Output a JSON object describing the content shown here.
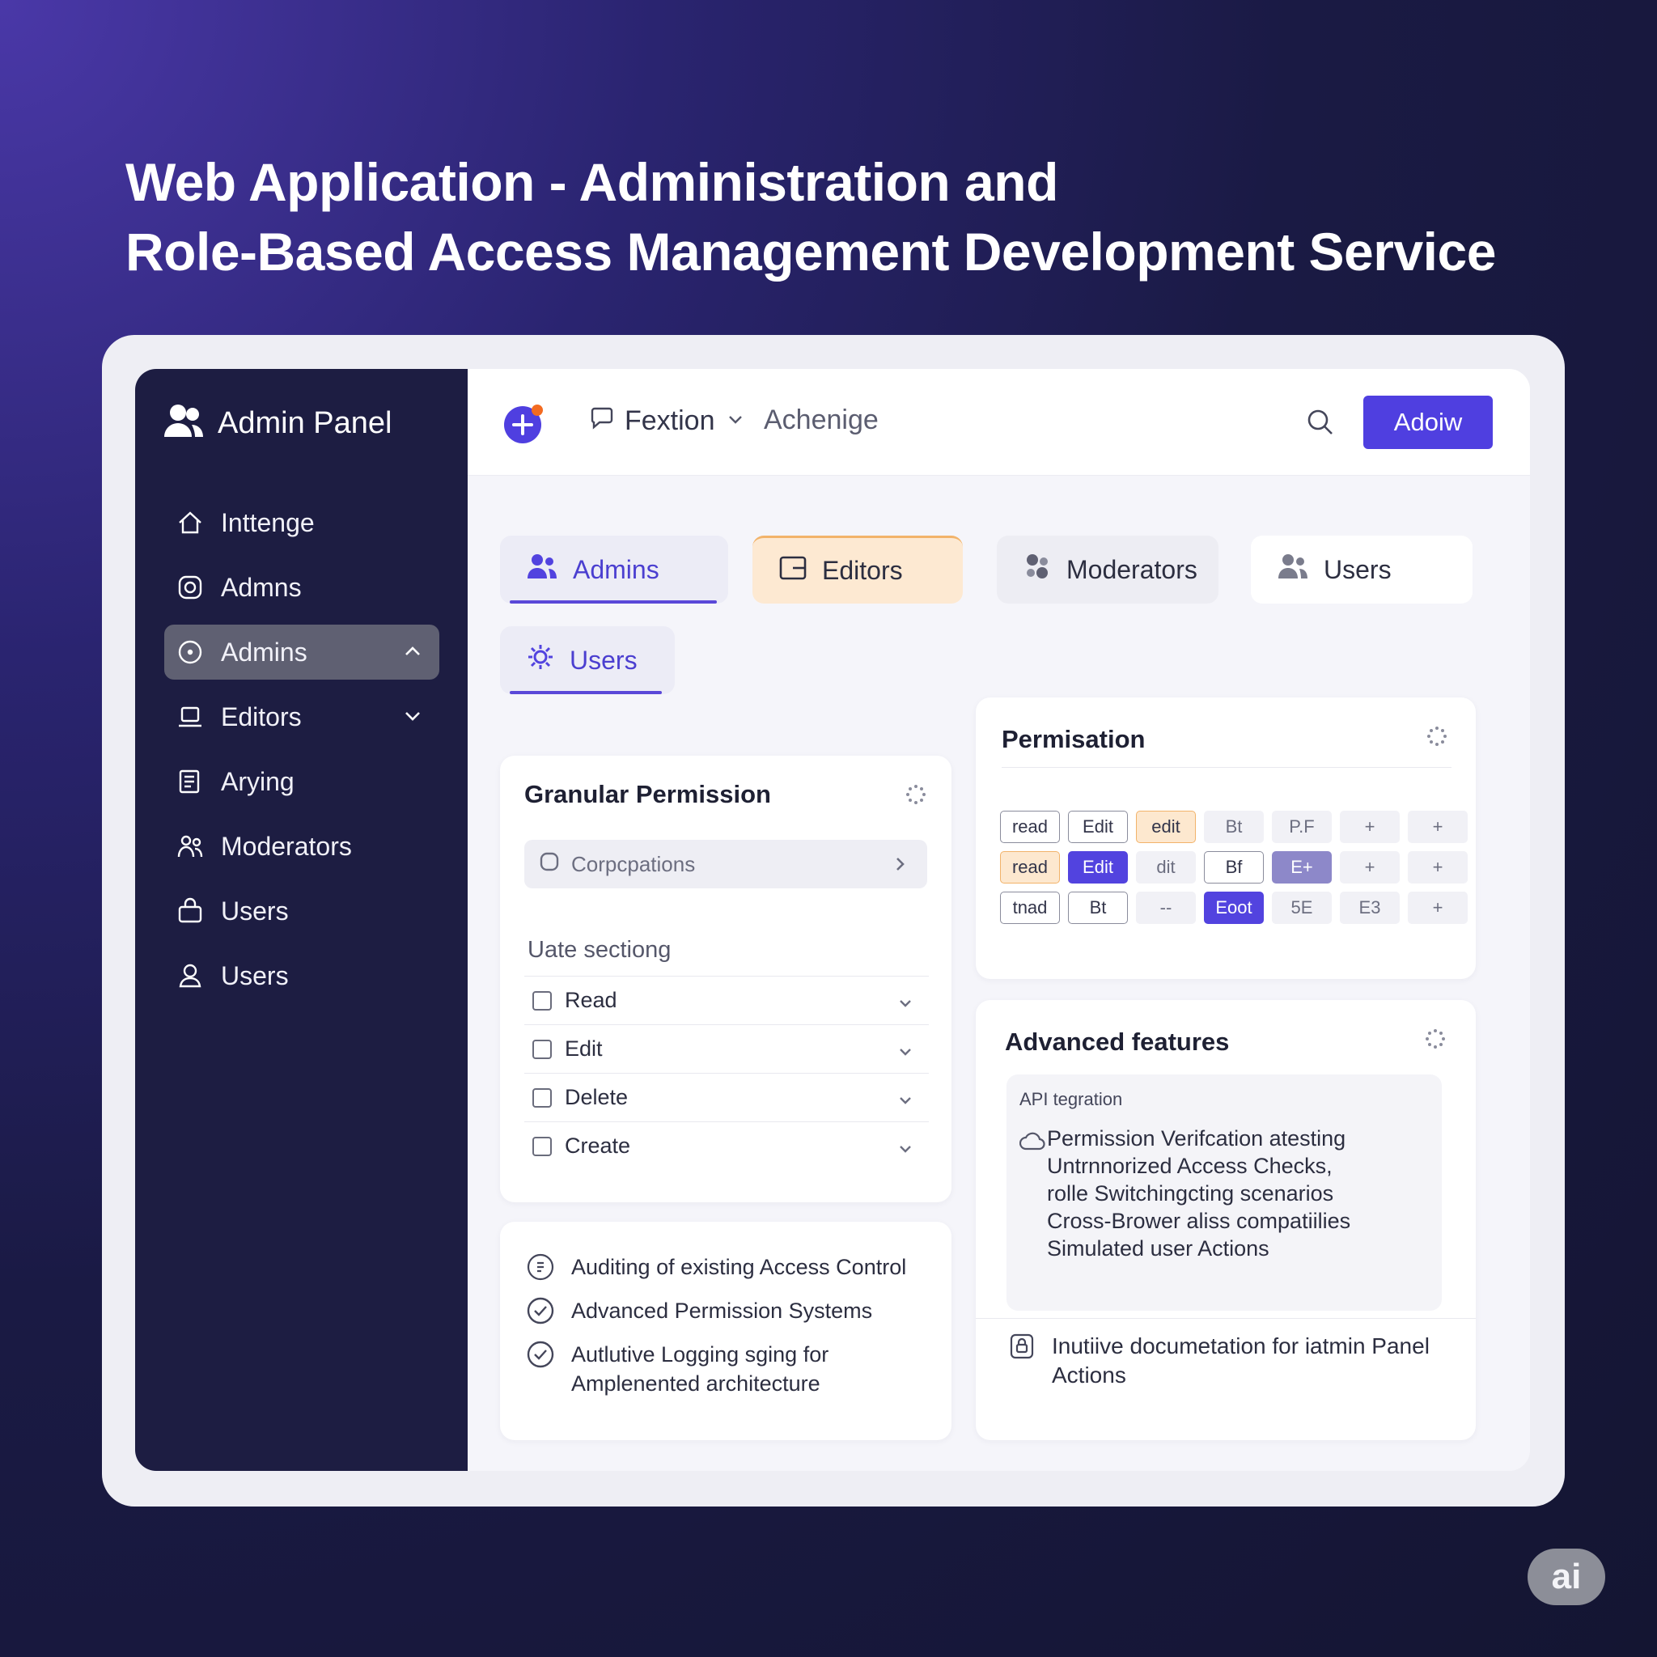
{
  "hero": {
    "title_line1": "Web Application - Administration and",
    "title_line2": "Role-Based Access Management Development Service"
  },
  "sidebar": {
    "brand": "Admin Panel",
    "items": [
      {
        "label": "Inttenge",
        "icon": "home-icon"
      },
      {
        "label": "Admns",
        "icon": "camera-icon"
      },
      {
        "label": "Admins",
        "icon": "circle-dot-icon",
        "active": true,
        "expanded": true
      },
      {
        "label": "Editors",
        "icon": "laptop-icon",
        "expanded": false
      },
      {
        "label": "Arying",
        "icon": "document-icon"
      },
      {
        "label": "Moderators",
        "icon": "people-icon"
      },
      {
        "label": "Users",
        "icon": "bag-icon"
      },
      {
        "label": "Users",
        "icon": "user-icon"
      }
    ]
  },
  "topbar": {
    "menu_label": "Fextion",
    "link_label": "Achenige",
    "button_label": "Adoiw"
  },
  "tabs": [
    {
      "label": "Admins",
      "icon": "users-icon"
    },
    {
      "label": "Editors",
      "icon": "folder-icon"
    },
    {
      "label": "Moderators",
      "icon": "pinwheel-icon"
    },
    {
      "label": "Users",
      "icon": "users-icon"
    },
    {
      "label": "Users",
      "icon": "gear-icon"
    }
  ],
  "granular": {
    "title": "Granular Permission",
    "search_placeholder": "Corpcpations",
    "section_label": "Uate sectiong",
    "items": [
      "Read",
      "Edit",
      "Delete",
      "Create"
    ]
  },
  "features": {
    "items": [
      "Auditing of existing Access Control",
      "Advanced Permission Systems",
      "Autlutive Logging sging for",
      "Amplenented architecture"
    ]
  },
  "permisation": {
    "title": "Permisation",
    "rows": [
      [
        {
          "t": "read",
          "s": "outline"
        },
        {
          "t": "Edit",
          "s": "outline"
        },
        {
          "t": "edit",
          "s": "orange"
        },
        {
          "t": "Bt",
          "s": "light"
        },
        {
          "t": "P.F",
          "s": "light"
        },
        {
          "t": "+",
          "s": "light"
        },
        {
          "t": "+",
          "s": "light"
        }
      ],
      [
        {
          "t": "read",
          "s": "orange"
        },
        {
          "t": "Edit",
          "s": "purple"
        },
        {
          "t": "dit",
          "s": "light"
        },
        {
          "t": "Bf",
          "s": "outline"
        },
        {
          "t": "E+",
          "s": "lavender"
        },
        {
          "t": "+",
          "s": "light"
        },
        {
          "t": "+",
          "s": "light"
        }
      ],
      [
        {
          "t": "tnad",
          "s": "outline"
        },
        {
          "t": "Bt",
          "s": "outline"
        },
        {
          "t": "--",
          "s": "light"
        },
        {
          "t": "Eoot",
          "s": "purple"
        },
        {
          "t": "5E",
          "s": "light"
        },
        {
          "t": "E3",
          "s": "light"
        },
        {
          "t": "+",
          "s": "light"
        }
      ]
    ]
  },
  "advanced": {
    "title": "Advanced features",
    "inner_label": "API tegration",
    "lines": [
      "Permission Verifcation atesting",
      "Untrnnorized Access Checks,",
      "rolle Switchingcting scenarios",
      "Cross-Brower aliss compatiilies",
      "Simulated user Actions"
    ],
    "doc_line1": "Inutiive documetation for iatmin Panel",
    "doc_line2": "Actions"
  },
  "badge": "ai"
}
